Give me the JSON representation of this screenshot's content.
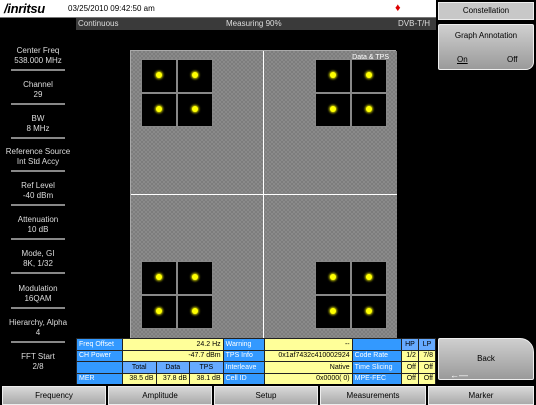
{
  "header": {
    "brand": "/inritsu",
    "datetime": "03/25/2010 09:42:50 am"
  },
  "status": {
    "mode": "Continuous",
    "measuring": "Measuring 90%",
    "standard": "DVB-T/H"
  },
  "left_params": [
    {
      "label": "Center Freq",
      "value": "538.000 MHz"
    },
    {
      "label": "Channel",
      "value": "29"
    },
    {
      "label": "BW",
      "value": "8 MHz"
    },
    {
      "label": "Reference Source",
      "value": "Int Std Accy"
    },
    {
      "label": "Ref Level",
      "value": "-40 dBm"
    },
    {
      "label": "Attenuation",
      "value": "10 dB"
    },
    {
      "label": "Mode, GI",
      "value": "8K, 1/32"
    },
    {
      "label": "Modulation",
      "value": "16QAM"
    },
    {
      "label": "Hierarchy, Alpha",
      "value": "4"
    },
    {
      "label": "FFT Start",
      "value": "2/8"
    }
  ],
  "graph": {
    "title": "Data & TPS"
  },
  "table": {
    "freq_offset_label": "Freq Offset",
    "freq_offset_value": "24.2 Hz",
    "warning_label": "Warning",
    "warning_value": "--",
    "hp": "HP",
    "lp": "LP",
    "ch_power_label": "CH Power",
    "ch_power_value": "-47.7 dBm",
    "tps_info_label": "TPS Info",
    "tps_info_value": "0x1af7432c410002924",
    "code_rate_label": "Code Rate",
    "code_rate_hp": "1/2",
    "code_rate_lp": "7/8",
    "col_total": "Total",
    "col_data": "Data",
    "col_tps": "TPS",
    "interleave_label": "Interleave",
    "interleave_value": "Native",
    "time_slicing_label": "Time Slicing",
    "time_slicing_hp": "Off",
    "time_slicing_lp": "Off",
    "mer_label": "MER",
    "mer_total": "38.5 dB",
    "mer_data": "37.8 dB",
    "mer_tps": "38.1 dB",
    "cell_id_label": "Cell ID",
    "cell_id_value": "0x0000(     0)",
    "mpe_fec_label": "MPE-FEC",
    "mpe_fec_hp": "Off",
    "mpe_fec_lp": "Off"
  },
  "right_panel": {
    "title": "Constellation",
    "annotation_label": "Graph Annotation",
    "on": "On",
    "off": "Off",
    "back": "Back"
  },
  "bottom_tabs": [
    "Frequency",
    "Amplitude",
    "Setup",
    "Measurements",
    "Marker"
  ],
  "colors": {
    "table_label": "#3399ff",
    "table_value": "#ffff99",
    "constellation_point": "#ffff00"
  }
}
